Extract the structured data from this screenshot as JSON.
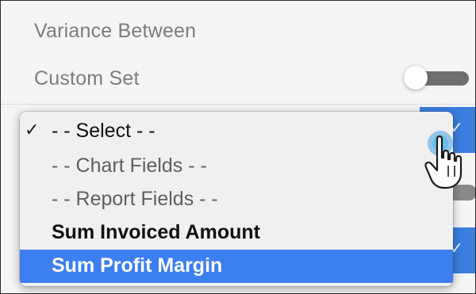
{
  "panel": {
    "section_label": "Variance Between",
    "custom_set_label": "Custom Set",
    "custom_set_toggle": "off"
  },
  "dropdown": {
    "options": [
      {
        "label": "- - Select - -",
        "selected": true
      },
      {
        "label": "- - Chart Fields - -",
        "selected": false
      },
      {
        "label": "- - Report Fields - -",
        "selected": false
      },
      {
        "label": "Sum Invoiced Amount",
        "selected": false
      },
      {
        "label": "Sum Profit Margin",
        "selected": false,
        "highlighted": true
      }
    ],
    "check_glyph": "✓"
  },
  "colors": {
    "accent": "#3d7ef0",
    "panel_bg": "#f5f5f5",
    "label_text": "#7d7d7d"
  },
  "icons": {
    "cursor": "hand-pointer-icon",
    "toggle": "toggle-switch-icon"
  }
}
